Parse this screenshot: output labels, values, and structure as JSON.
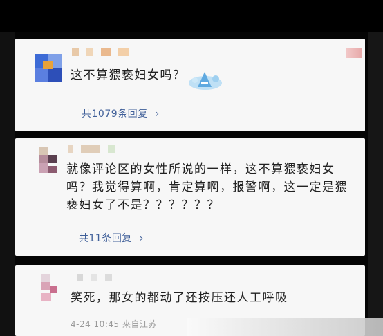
{
  "comments": [
    {
      "text": "这不算猥亵妇女吗？",
      "replies_label": "共1079条回复",
      "reply_chevron": "›"
    },
    {
      "line1": "就像评论区的女性所说的一样，这不算猥亵妇女",
      "line2": "吗？我觉得算啊，肯定算啊，报警啊，这一定是猥",
      "line3": "亵妇女了不是？？？？？？",
      "replies_label": "共11条回复",
      "reply_chevron": "›"
    },
    {
      "text": "笑死，那女的都动了还按压还人工呼吸",
      "meta": "4-24 10:45 来自江苏"
    }
  ],
  "icons": {
    "sticker": "blue-cartoon-sticker-icon",
    "avatar": "pixelated-avatar-icon"
  },
  "colors": {
    "card_bg": "#f7f7f7",
    "reply_link": "#3f5f99",
    "text": "#222222",
    "meta": "#9a9a9a",
    "background": "#000000"
  }
}
